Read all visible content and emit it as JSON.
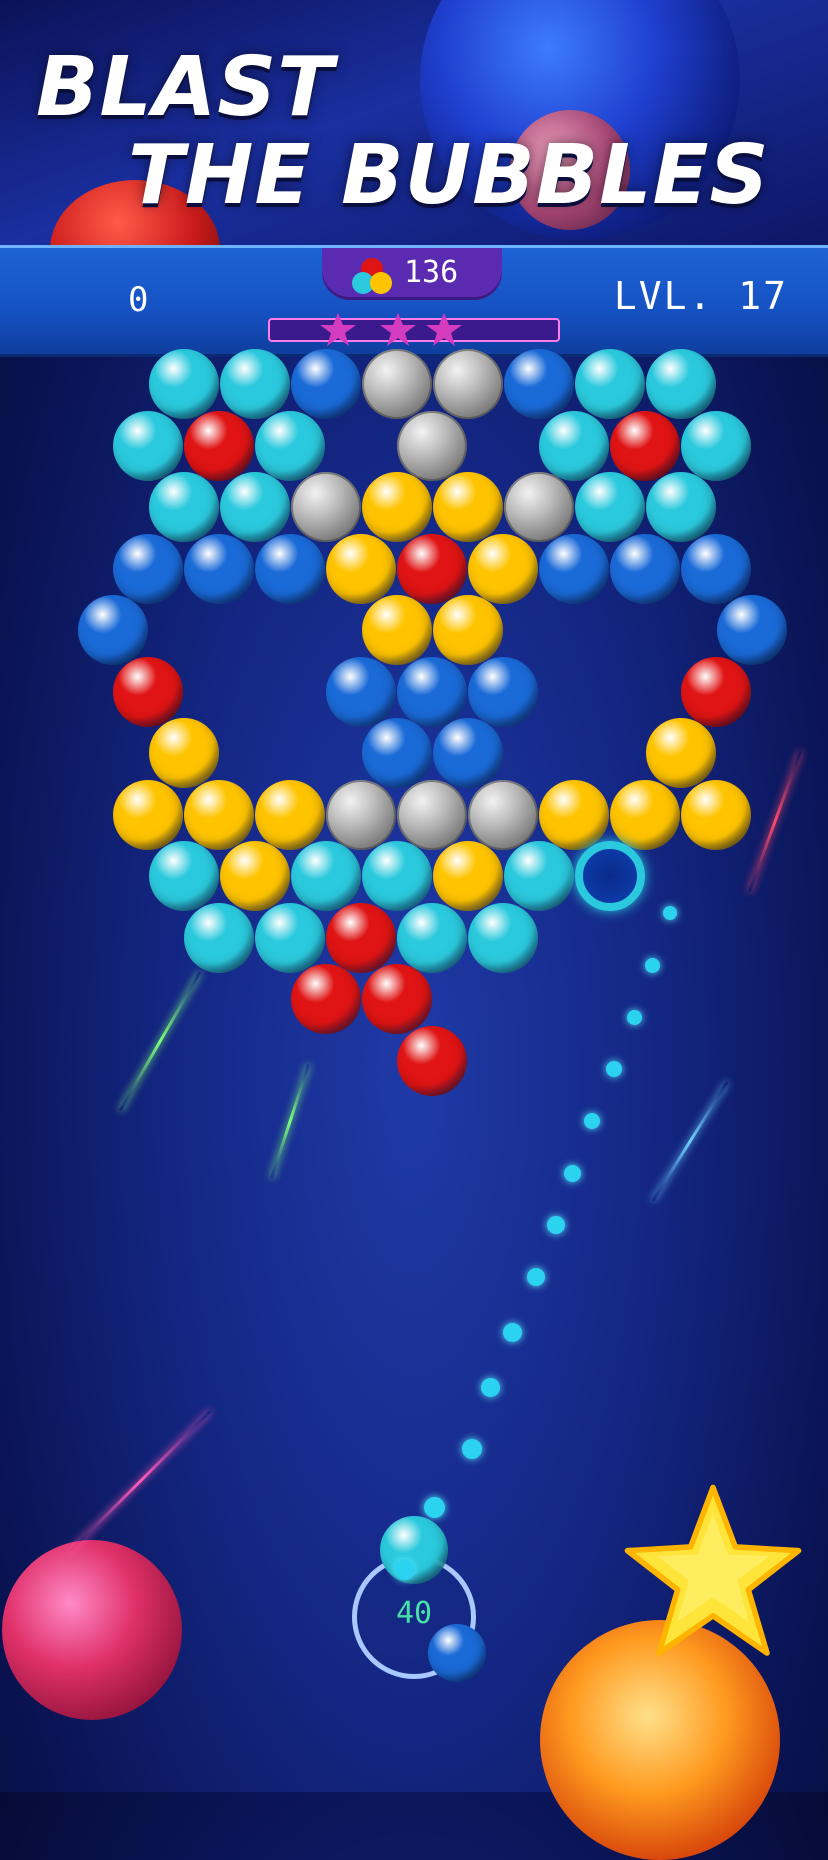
{
  "promo": {
    "line1": "BLAST",
    "line2": "THE BUBBLES"
  },
  "hud": {
    "score": "0",
    "level": "LVL. 17",
    "moves": "136",
    "balls_icon": "tricolor-balls-icon",
    "stars_earned": 3,
    "progress_fraction": 0.0
  },
  "shooter": {
    "shots_left": "40",
    "current_color": "cyan",
    "next_color": "blue"
  },
  "colors": {
    "cyan": "#2bc9dd",
    "blue": "#1a6ad8",
    "red": "#e01414",
    "yellow": "#ffc400",
    "stone": "#9a9a9a",
    "accent_purple": "#5a2bb0",
    "star_pink": "#d53bbf"
  },
  "grid": {
    "rows": [
      "_ c c b S S b c c _",
      "c r c _ S _ c r c",
      "_ c c S y y S c c _",
      "b b b y r y b b b",
      "b _ _ _ y y _ _ _ b",
      "r _ _ b b b _ _ r",
      "_ y _ _ b b _ _ y _",
      "y y y S S S y y y",
      "_ c y c c y c h _ _",
      "_ c c r c c _ _",
      "_ _ _ r r _ _ _ _ _",
      "_ _ _ _ r _ _ _ _"
    ]
  }
}
